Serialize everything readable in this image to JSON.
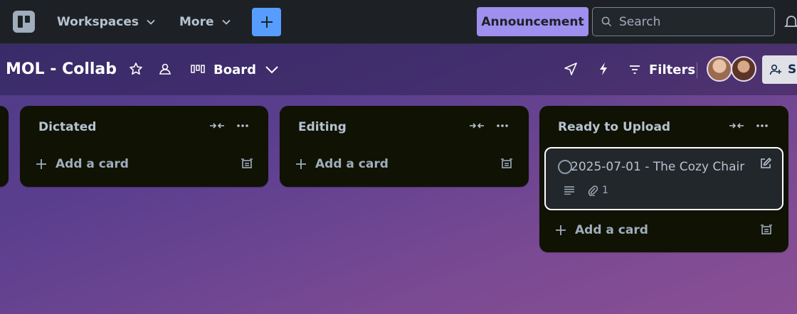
{
  "topnav": {
    "workspaces_label": "Workspaces",
    "more_label": "More",
    "announcement_label": "Announcement",
    "search_placeholder": "Search"
  },
  "board": {
    "title": "MOL - Collab",
    "view_label": "Board",
    "filters_label": "Filters",
    "share_label": "Sh"
  },
  "lists": [
    {
      "title": "Dictated",
      "add_card_label": "Add a card"
    },
    {
      "title": "Editing",
      "add_card_label": "Add a card"
    },
    {
      "title": "Ready to Upload",
      "add_card_label": "Add a card",
      "cards": [
        {
          "title": "2025-07-01 - The Cozy Chair",
          "attachments": "1"
        }
      ]
    }
  ],
  "colors": {
    "topnav_bg": "#1d2125",
    "accent_blue": "#579dff",
    "announcement_purple": "#9f8fef",
    "list_bg": "#101204",
    "card_bg": "#22272b"
  }
}
